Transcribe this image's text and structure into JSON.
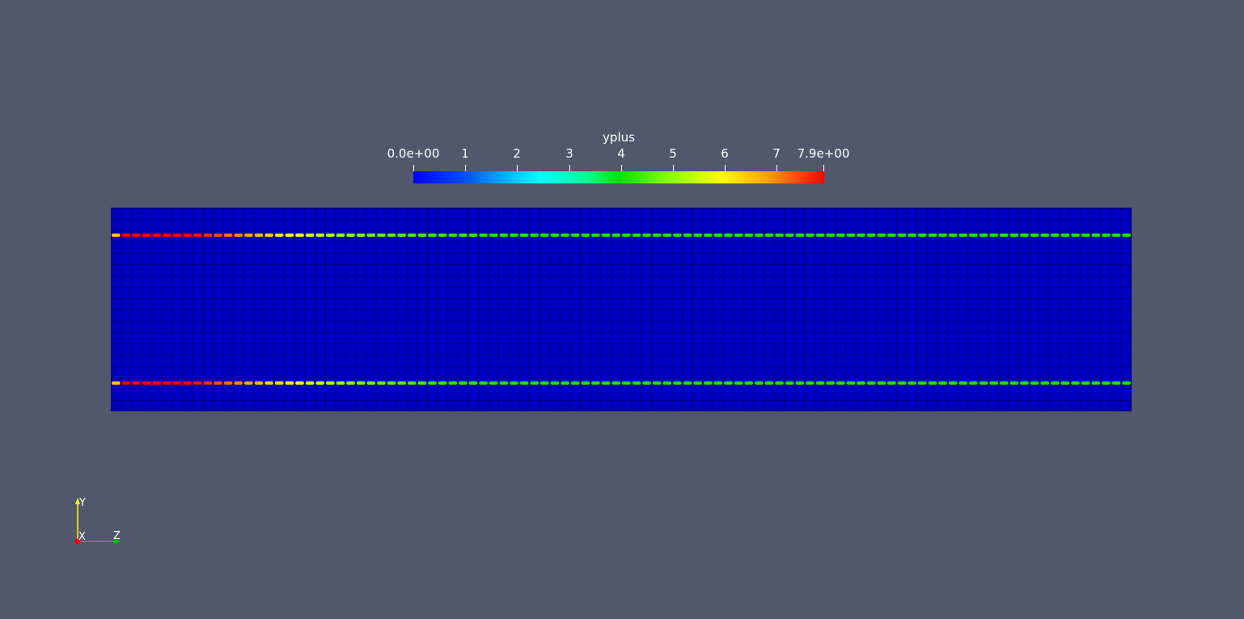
{
  "scalar_bar": {
    "title": "yplus",
    "range": [
      0.0,
      7.9
    ],
    "colormap": "Rainbow (Jet)",
    "ticks": [
      {
        "label": "0.0e+00",
        "value": 0.0
      },
      {
        "label": "1",
        "value": 1
      },
      {
        "label": "2",
        "value": 2
      },
      {
        "label": "3",
        "value": 3
      },
      {
        "label": "4",
        "value": 4
      },
      {
        "label": "5",
        "value": 5
      },
      {
        "label": "6",
        "value": 6
      },
      {
        "label": "7",
        "value": 7
      },
      {
        "label": "7.9e+00",
        "value": 7.9
      }
    ]
  },
  "render": {
    "background_color": "#52576b",
    "interior_color": "#0000c0",
    "mesh_columns": 100,
    "wall_cells_yplus_profile": [
      6.4,
      7.9,
      7.9,
      7.9,
      7.9,
      7.9,
      7.9,
      7.9,
      7.8,
      7.6,
      7.4,
      7.2,
      7.0,
      6.8,
      6.6,
      6.4,
      6.2,
      6.0,
      5.8,
      5.6,
      5.4,
      5.2,
      5.0,
      4.9,
      4.8,
      4.7,
      4.6,
      4.5,
      4.5,
      4.4,
      4.4,
      4.3,
      4.3,
      4.2,
      4.2,
      4.2,
      4.1,
      4.1,
      4.1,
      4.1
    ]
  },
  "orientation_axes": {
    "x_label": "X",
    "y_label": "Y",
    "z_label": "Z",
    "x_color": "#ff0000",
    "y_color": "#ffff00",
    "z_color": "#00c800"
  }
}
